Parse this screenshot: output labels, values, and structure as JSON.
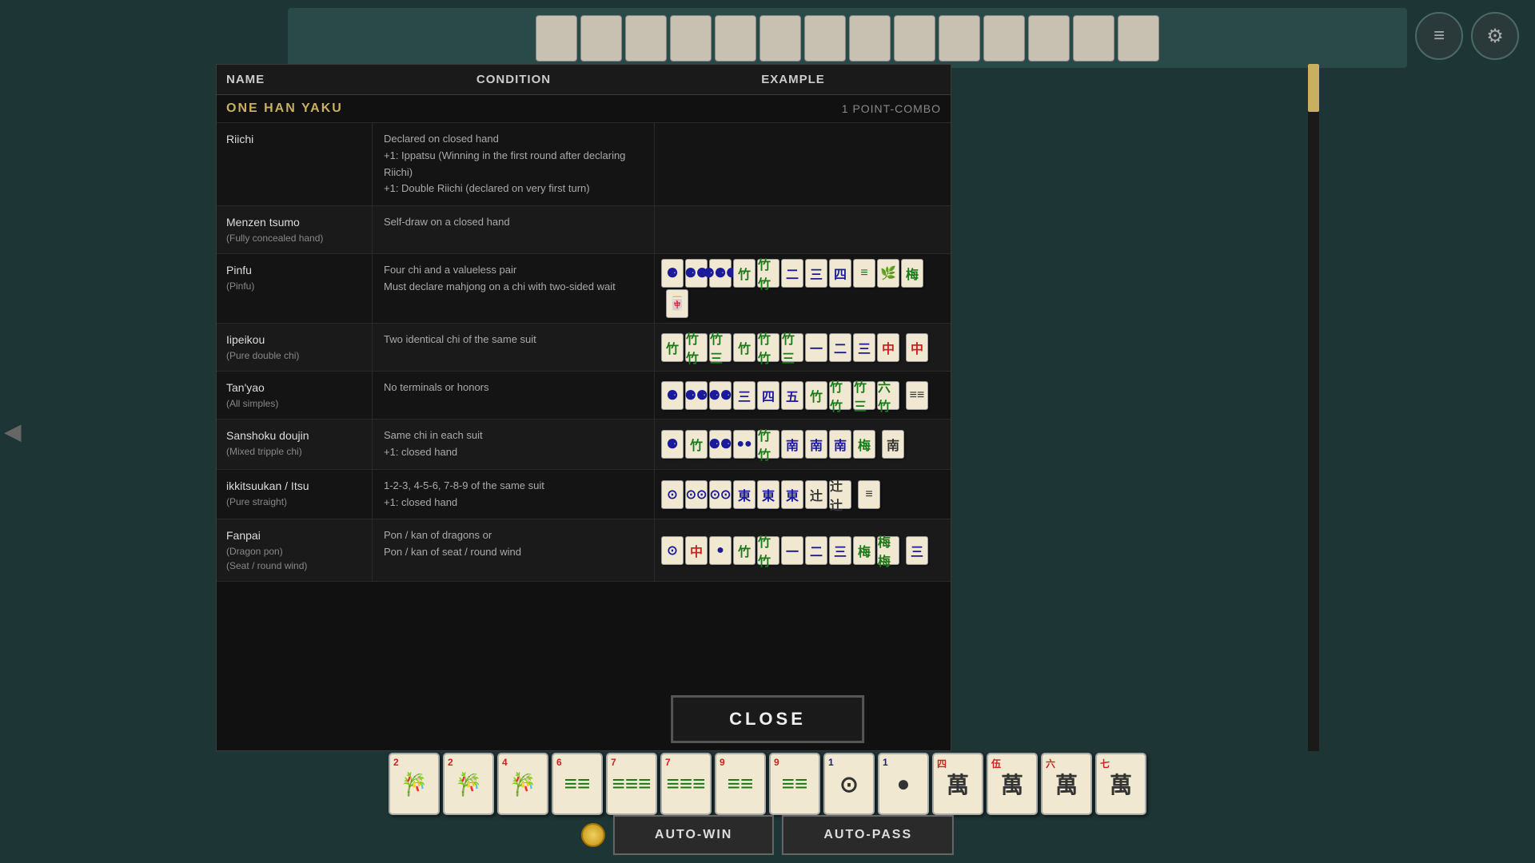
{
  "header": {
    "name_col": "NAME",
    "condition_col": "CONDITION",
    "example_col": "EXAMPLE"
  },
  "section": {
    "title": "ONE HAN YAKU",
    "points": "1 POINT-COMBO"
  },
  "yaku": [
    {
      "name": "Riichi",
      "name_sub": "",
      "condition": "Declared on closed hand\n+1: Ippatsu (Winning in the first round after declaring Riichi)\n+1: Double Riichi (declared on very first turn)",
      "has_example": false
    },
    {
      "name": "Menzen tsumo",
      "name_sub": "(Fully concealed hand)",
      "condition": "Self-draw on a closed hand",
      "has_example": false
    },
    {
      "name": "Pinfu",
      "name_sub": "(Pinfu)",
      "condition": "Four chi and a valueless pair\nMust declare mahjong on a chi with two-sided wait",
      "has_example": true
    },
    {
      "name": "Iipeikou",
      "name_sub": "(Pure double chi)",
      "condition": "Two identical chi of the same suit",
      "has_example": true
    },
    {
      "name": "Tan'yao",
      "name_sub": "(All simples)",
      "condition": "No terminals or honors",
      "has_example": true
    },
    {
      "name": "Sanshoku doujin",
      "name_sub": "(Mixed tripple chi)",
      "condition": "Same chi in each suit\n+1: closed hand",
      "has_example": true
    },
    {
      "name": "ikkitsuukan / Itsu",
      "name_sub": "(Pure straight)",
      "condition": "1-2-3, 4-5-6, 7-8-9 of the same suit\n+1: closed hand",
      "has_example": true
    },
    {
      "name": "Fanpai",
      "name_sub": "(Dragon pon)\n(Seat / round wind)",
      "condition": "Pon / kan of dragons or\nPon / kan of seat / round wind",
      "has_example": true
    }
  ],
  "buttons": {
    "close": "CLOSE",
    "auto_win": "AUTO-WIN",
    "auto_pass": "AUTO-PASS"
  },
  "icons": {
    "notes": "≡",
    "settings": "⚙"
  }
}
